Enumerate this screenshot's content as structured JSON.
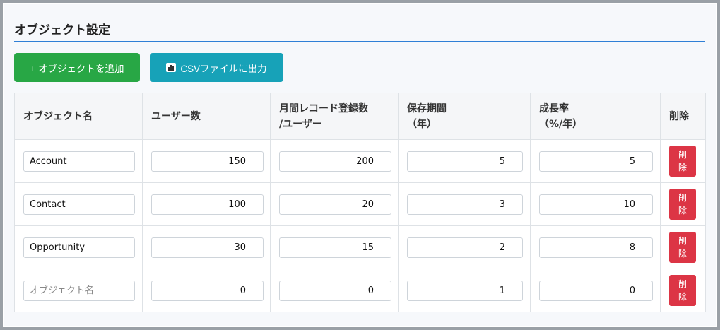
{
  "page": {
    "title": "オブジェクト設定"
  },
  "toolbar": {
    "add_label": "+ オブジェクトを追加",
    "csv_label": "CSVファイルに出力",
    "csv_icon": "bar-chart-icon"
  },
  "table": {
    "headers": {
      "name": "オブジェクト名",
      "users": "ユーザー数",
      "records_line1": "月間レコード登録数",
      "records_line2": "/ユーザー",
      "retention_line1": "保存期間",
      "retention_line2": "（年）",
      "growth_line1": "成長率",
      "growth_line2": "（%/年）",
      "delete": "削除"
    },
    "name_placeholder": "オブジェクト名",
    "delete_label": "削除",
    "rows": [
      {
        "name": "Account",
        "users": "150",
        "records": "200",
        "retention": "5",
        "growth": "5"
      },
      {
        "name": "Contact",
        "users": "100",
        "records": "20",
        "retention": "3",
        "growth": "10"
      },
      {
        "name": "Opportunity",
        "users": "30",
        "records": "15",
        "retention": "2",
        "growth": "8"
      },
      {
        "name": "",
        "users": "0",
        "records": "0",
        "retention": "1",
        "growth": "0"
      }
    ]
  },
  "colors": {
    "add_button": "#28a745",
    "csv_button": "#17a2b8",
    "delete_button": "#dc3545",
    "title_rule": "#2f7fd6"
  }
}
